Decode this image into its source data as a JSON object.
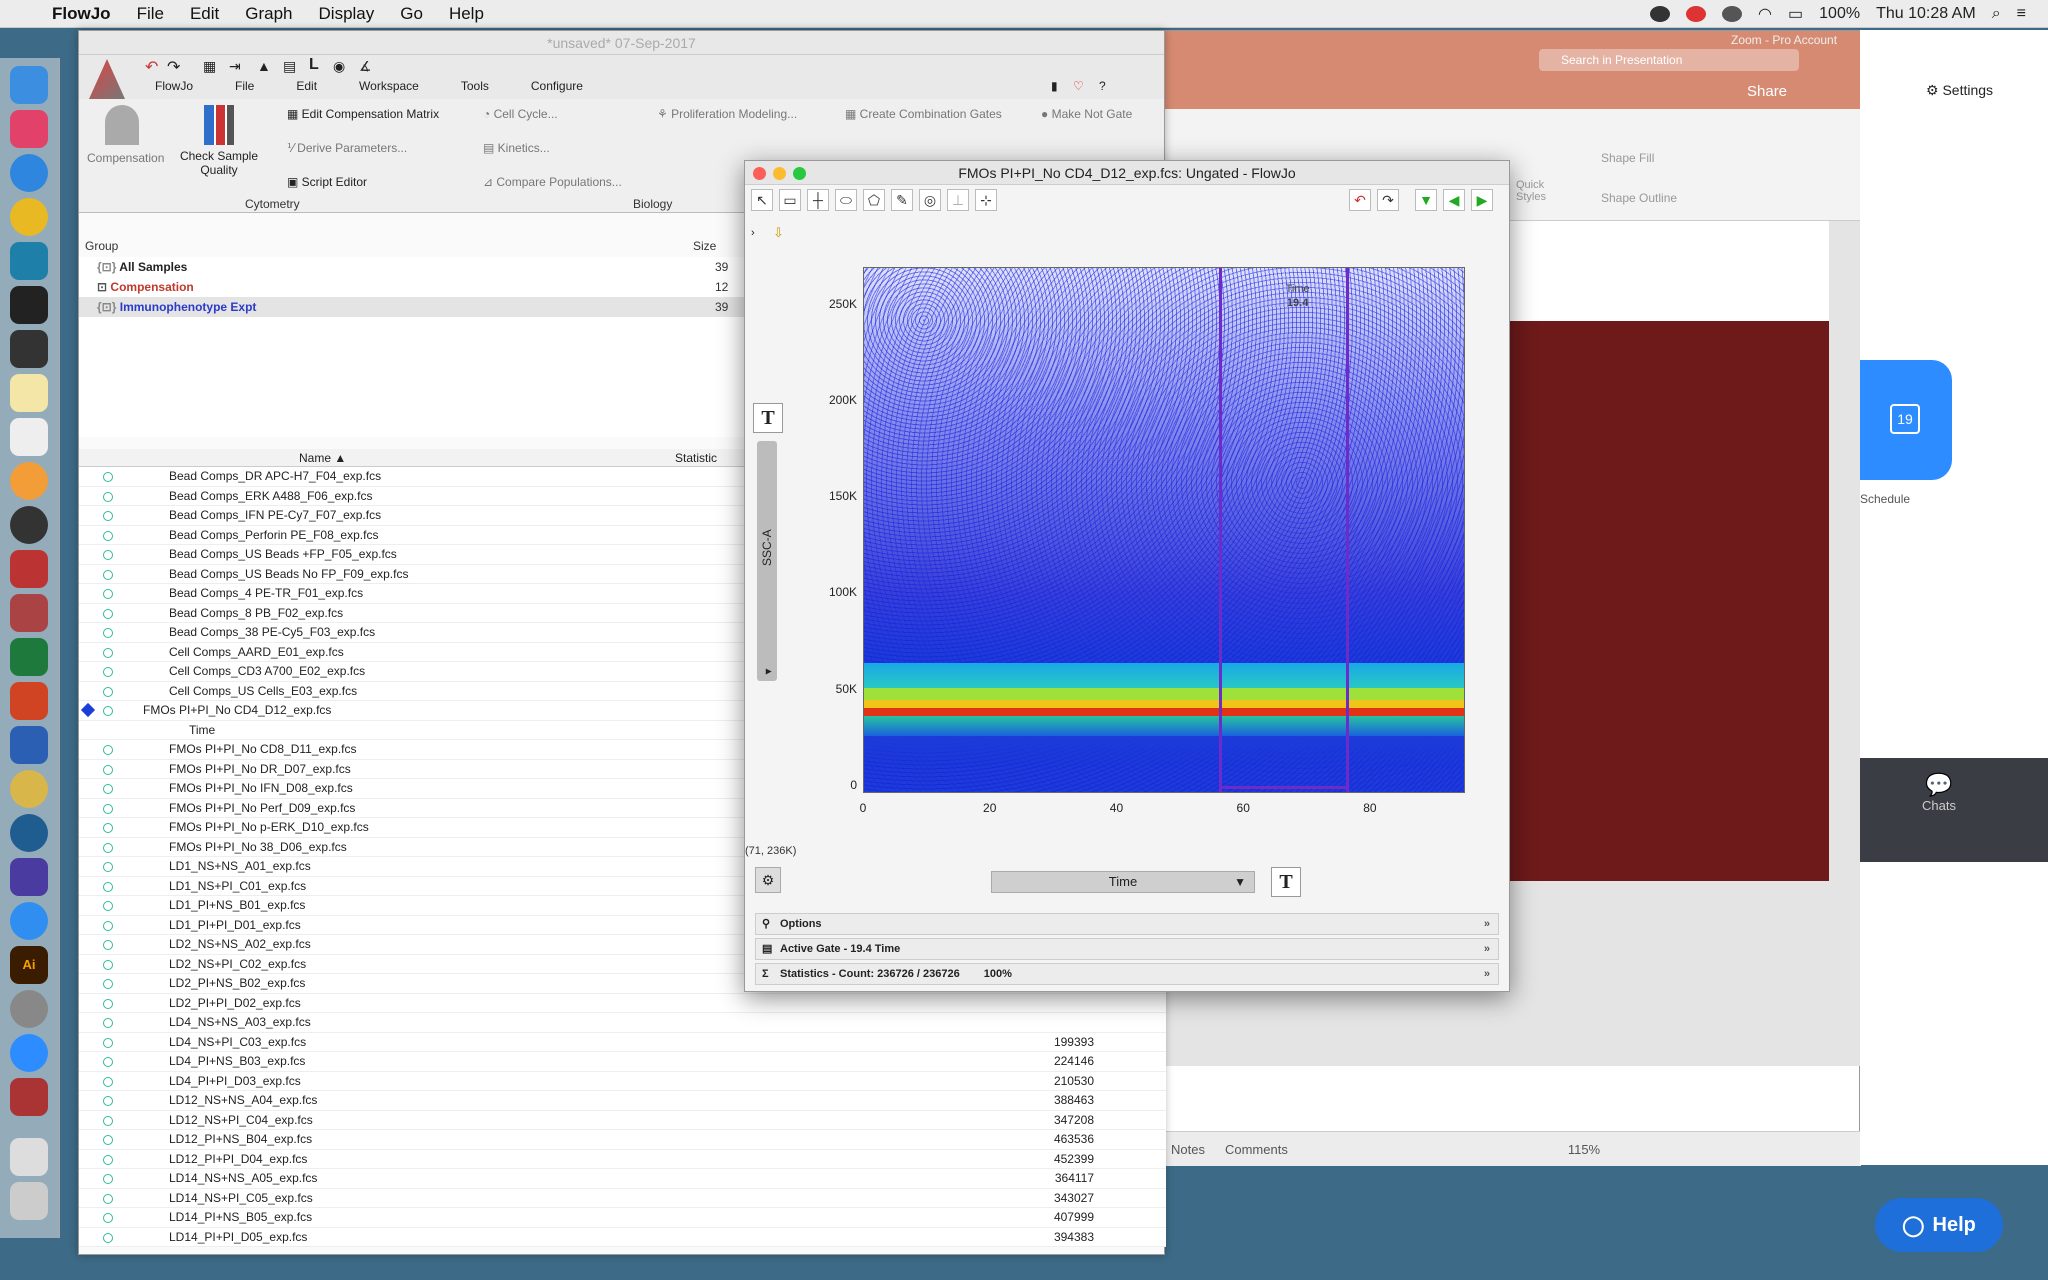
{
  "menubar": {
    "app": "FlowJo",
    "items": [
      "File",
      "Edit",
      "Graph",
      "Display",
      "Go",
      "Help"
    ],
    "battery": "100%",
    "clock": "Thu 10:28 AM"
  },
  "flowjo": {
    "title": "*unsaved* 07-Sep-2017",
    "tabs": [
      "FlowJo",
      "File",
      "Edit",
      "Workspace",
      "Tools",
      "Configure"
    ],
    "ribbon": {
      "compensation": "Compensation",
      "check_sample_quality": "Check Sample Quality",
      "edit_comp_matrix": "Edit Compensation Matrix",
      "derive_parameters": "Derive Parameters...",
      "script_editor": "Script Editor",
      "cell_cycle": "Cell Cycle...",
      "kinetics": "Kinetics...",
      "compare_populations": "Compare Populations...",
      "proliferation_modeling": "Proliferation Modeling...",
      "create_combination_gates": "Create Combination Gates",
      "make_not_gate": "Make Not Gate",
      "section_cytometry": "Cytometry",
      "section_biology": "Biology"
    },
    "group_header": {
      "group": "Group",
      "size": "Size"
    },
    "groups": [
      {
        "name": "All Samples",
        "size": "39",
        "color": "#222222"
      },
      {
        "name": "Compensation",
        "size": "12",
        "color": "#c0392b"
      },
      {
        "name": "Immunophenotype Expt",
        "size": "39",
        "color": "#2b3bc9"
      }
    ],
    "columns": {
      "name": "Name",
      "statistic": "Statistic"
    },
    "samples": [
      {
        "name": "Bead Comps_DR APC-H7_F04_exp.fcs",
        "value": ""
      },
      {
        "name": "Bead Comps_ERK A488_F06_exp.fcs",
        "value": ""
      },
      {
        "name": "Bead Comps_IFN PE-Cy7_F07_exp.fcs",
        "value": ""
      },
      {
        "name": "Bead Comps_Perforin PE_F08_exp.fcs",
        "value": ""
      },
      {
        "name": "Bead Comps_US Beads +FP_F05_exp.fcs",
        "value": ""
      },
      {
        "name": "Bead Comps_US Beads No FP_F09_exp.fcs",
        "value": ""
      },
      {
        "name": "Bead Comps_4 PE-TR_F01_exp.fcs",
        "value": ""
      },
      {
        "name": "Bead Comps_8 PB_F02_exp.fcs",
        "value": ""
      },
      {
        "name": "Bead Comps_38 PE-Cy5_F03_exp.fcs",
        "value": ""
      },
      {
        "name": "Cell Comps_AARD_E01_exp.fcs",
        "value": ""
      },
      {
        "name": "Cell Comps_CD3 A700_E02_exp.fcs",
        "value": ""
      },
      {
        "name": "Cell Comps_US Cells_E03_exp.fcs",
        "value": ""
      },
      {
        "name": "FMOs PI+PI_No CD4_D12_exp.fcs",
        "value": ""
      },
      {
        "name": "Time",
        "value": ""
      },
      {
        "name": "FMOs PI+PI_No CD8_D11_exp.fcs",
        "value": ""
      },
      {
        "name": "FMOs PI+PI_No DR_D07_exp.fcs",
        "value": ""
      },
      {
        "name": "FMOs PI+PI_No IFN_D08_exp.fcs",
        "value": ""
      },
      {
        "name": "FMOs PI+PI_No Perf_D09_exp.fcs",
        "value": ""
      },
      {
        "name": "FMOs PI+PI_No p-ERK_D10_exp.fcs",
        "value": ""
      },
      {
        "name": "FMOs PI+PI_No 38_D06_exp.fcs",
        "value": ""
      },
      {
        "name": "LD1_NS+NS_A01_exp.fcs",
        "value": ""
      },
      {
        "name": "LD1_NS+PI_C01_exp.fcs",
        "value": ""
      },
      {
        "name": "LD1_PI+NS_B01_exp.fcs",
        "value": ""
      },
      {
        "name": "LD1_PI+PI_D01_exp.fcs",
        "value": ""
      },
      {
        "name": "LD2_NS+NS_A02_exp.fcs",
        "value": ""
      },
      {
        "name": "LD2_NS+PI_C02_exp.fcs",
        "value": ""
      },
      {
        "name": "LD2_PI+NS_B02_exp.fcs",
        "value": ""
      },
      {
        "name": "LD2_PI+PI_D02_exp.fcs",
        "value": ""
      },
      {
        "name": "LD4_NS+NS_A03_exp.fcs",
        "value": ""
      },
      {
        "name": "LD4_NS+PI_C03_exp.fcs",
        "value": "199393"
      },
      {
        "name": "LD4_PI+NS_B03_exp.fcs",
        "value": "224146"
      },
      {
        "name": "LD4_PI+PI_D03_exp.fcs",
        "value": "210530"
      },
      {
        "name": "LD12_NS+NS_A04_exp.fcs",
        "value": "388463"
      },
      {
        "name": "LD12_NS+PI_C04_exp.fcs",
        "value": "347208"
      },
      {
        "name": "LD12_PI+NS_B04_exp.fcs",
        "value": "463536"
      },
      {
        "name": "LD12_PI+PI_D04_exp.fcs",
        "value": "452399"
      },
      {
        "name": "LD14_NS+NS_A05_exp.fcs",
        "value": "364117"
      },
      {
        "name": "LD14_NS+PI_C05_exp.fcs",
        "value": "343027"
      },
      {
        "name": "LD14_PI+NS_B05_exp.fcs",
        "value": "407999"
      },
      {
        "name": "LD14_PI+PI_D05_exp.fcs",
        "value": "394383"
      }
    ]
  },
  "graph_window": {
    "title": "FMOs PI+PI_No CD4_D12_exp.fcs: Ungated - FlowJo",
    "y_axis": "SSC-A",
    "x_axis": "Time",
    "y_ticks": [
      "250K",
      "200K",
      "150K",
      "100K",
      "50K",
      "0"
    ],
    "x_ticks": [
      "0",
      "20",
      "40",
      "60",
      "80"
    ],
    "cursor_readout": "(71, 236K)",
    "gate_label": "Time",
    "gate_pct": "19.4",
    "options_label": "Options",
    "active_gate": "Active Gate - 19.4 Time",
    "statistics": "Statistics - Count: 236726 / 236726",
    "statistics_pct": "100%",
    "gate_range_time": [
      56,
      76
    ]
  },
  "background": {
    "ppt_search": "Search in Presentation",
    "ppt_share": "Share",
    "ppt_account": "Zoom - Pro Account",
    "ppt_quick_styles": "Quick Styles",
    "ppt_shape_fill": "Shape Fill",
    "ppt_shape_outline": "Shape Outline",
    "ppt_notes": "Notes",
    "ppt_comments": "Comments",
    "ppt_zoom": "115%",
    "zoom_settings": "Settings",
    "zoom_schedule": "Schedule",
    "zoom_calendar_day": "19",
    "zoom_chats": "Chats",
    "help": "Help"
  },
  "colors": {
    "plot_dots": "#1c3bd8",
    "gate": "#6d2cc9",
    "slide": "#6e1a1a",
    "help_button": "#1e6fd9"
  }
}
